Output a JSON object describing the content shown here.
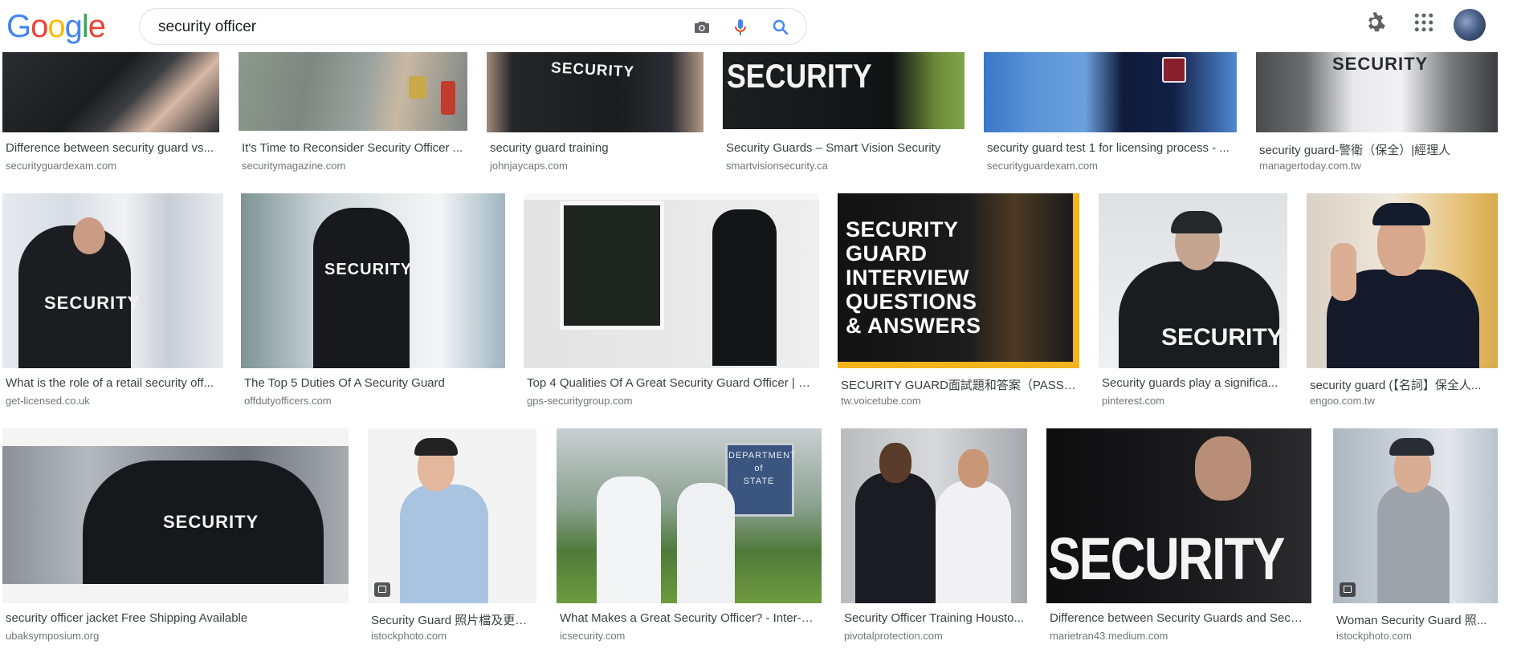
{
  "header": {
    "logo_letters": [
      "G",
      "o",
      "o",
      "g",
      "l",
      "e"
    ],
    "logo_colors": [
      "#4285f4",
      "#ea4335",
      "#fbbc05",
      "#4285f4",
      "#34a853",
      "#ea4335"
    ],
    "search_value": "security officer",
    "icons": {
      "camera": "camera-icon",
      "mic": "microphone-icon",
      "search": "search-icon",
      "settings": "gear-icon",
      "apps": "apps-grid-icon",
      "avatar": "avatar"
    },
    "accent_blue": "#4285f4"
  },
  "results": [
    {
      "caption": "Difference between security guard vs...",
      "source": "securityguardexam.com"
    },
    {
      "caption": "It's Time to Reconsider Security Officer ...",
      "source": "securitymagazine.com"
    },
    {
      "caption": "security guard training",
      "source": "johnjaycaps.com",
      "image_text": "SECURITY"
    },
    {
      "caption": "Security Guards – Smart Vision Security",
      "source": "smartvisionsecurity.ca",
      "image_text": "SECURITY"
    },
    {
      "caption": "security guard test 1 for licensing process - ...",
      "source": "securityguardexam.com"
    },
    {
      "caption": "security guard-警衛（保全）|經理人",
      "source": "managertoday.com.tw",
      "image_text": "SECURITY"
    },
    {
      "caption": "What is the role of a retail security off...",
      "source": "get-licensed.co.uk",
      "image_text": "SECURITY"
    },
    {
      "caption": "The Top 5 Duties Of A Security Guard",
      "source": "offdutyofficers.com",
      "image_text": "SECURITY"
    },
    {
      "caption": "Top 4 Qualities Of A Great Security Guard Officer | B...",
      "source": "gps-securitygroup.com"
    },
    {
      "caption": "SECURITY GUARD面試題和答案（PASS你...",
      "source": "tw.voicetube.com",
      "image_lines": [
        "SECURITY",
        "GUARD",
        "INTERVIEW",
        "QUESTIONS",
        "& ANSWERS"
      ]
    },
    {
      "caption": "Security guards play a significa...",
      "source": "pinterest.com",
      "image_text": "SECURITY"
    },
    {
      "caption": "security guard (【名詞】保全人...",
      "source": "engoo.com.tw",
      "image_text": "SECURITY"
    },
    {
      "caption": "security officer jacket Free Shipping Available",
      "source": "ubaksymposium.org",
      "image_text": "SECURITY"
    },
    {
      "caption": "Security Guard 照片檔及更多...",
      "source": "istockphoto.com"
    },
    {
      "caption": "What Makes a Great Security Officer? - Inter-C...",
      "source": "icsecurity.com",
      "image_lines": [
        "DEPARTMENT",
        "of",
        "STATE"
      ]
    },
    {
      "caption": "Security Officer Training Housto...",
      "source": "pivotalprotection.com"
    },
    {
      "caption": "Difference between Security Guards and Secur...",
      "source": "marietran43.medium.com",
      "image_text": "SECURITY"
    },
    {
      "caption": "Woman Security Guard 照...",
      "source": "istockphoto.com"
    }
  ]
}
